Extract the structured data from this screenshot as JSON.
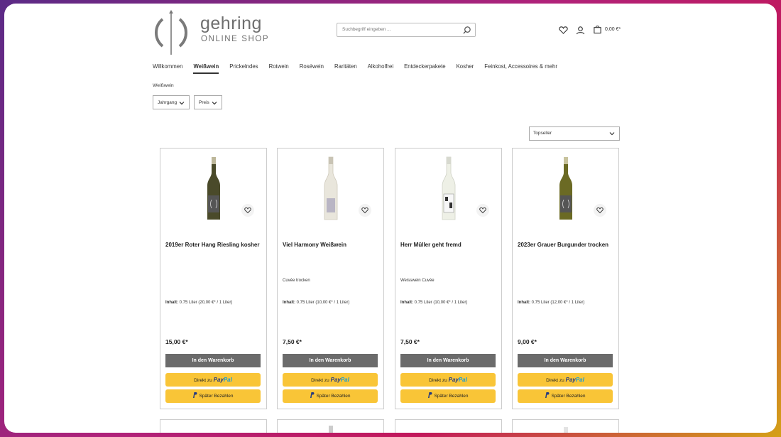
{
  "brand": {
    "name": "gehring",
    "tagline": "ONLINE SHOP"
  },
  "search": {
    "placeholder": "Suchbegriff eingeben ..."
  },
  "header": {
    "cart_amount": "0,00 €*",
    "icons": [
      "heart-icon",
      "user-icon",
      "cart-icon"
    ]
  },
  "nav": [
    {
      "label": "Willkommen",
      "active": false
    },
    {
      "label": "Weißwein",
      "active": true
    },
    {
      "label": "Prickelndes",
      "active": false
    },
    {
      "label": "Rotwein",
      "active": false
    },
    {
      "label": "Roséwein",
      "active": false
    },
    {
      "label": "Raritäten",
      "active": false
    },
    {
      "label": "Alkoholfrei",
      "active": false
    },
    {
      "label": "Entdeckerpakete",
      "active": false
    },
    {
      "label": "Kosher",
      "active": false
    },
    {
      "label": "Feinkost, Accessoires & mehr",
      "active": false
    }
  ],
  "breadcrumb": "Weißwein",
  "filters": {
    "vintage": "Jahrgang",
    "price": "Preis"
  },
  "sort": {
    "selected": "Topseller"
  },
  "labels": {
    "content": "Inhalt:",
    "add_to_cart": "In den Warenkorb",
    "paypal_direct": "Direkt zu",
    "paypal_pay": "Pay",
    "paypal_pal": "Pal",
    "pay_later": "Später Bezahlen"
  },
  "products": [
    {
      "name": "2019er Roter Hang Riesling kosher",
      "subtitle": "",
      "content": "0.75 Liter (20,00 €* / 1 Liter)",
      "price": "15,00 €*"
    },
    {
      "name": "Viel Harmony Weißwein",
      "subtitle": "Cuvée trocken",
      "content": "0.75 Liter (10,00 €* / 1 Liter)",
      "price": "7,50 €*"
    },
    {
      "name": "Herr Müller geht fremd",
      "subtitle": "Weisswein Cuvée",
      "content": "0.75 Liter (10,00 €* / 1 Liter)",
      "price": "7,50 €*"
    },
    {
      "name": "2023er Grauer Burgunder trocken",
      "subtitle": "",
      "content": "0.75 Liter (12,00 €* / 1 Liter)",
      "price": "9,00 €*"
    }
  ],
  "colors": {
    "cart_button": "#6b6b6b",
    "paypal_button": "#f9c537",
    "paypal_dark": "#253b80",
    "paypal_light": "#179bd7"
  }
}
